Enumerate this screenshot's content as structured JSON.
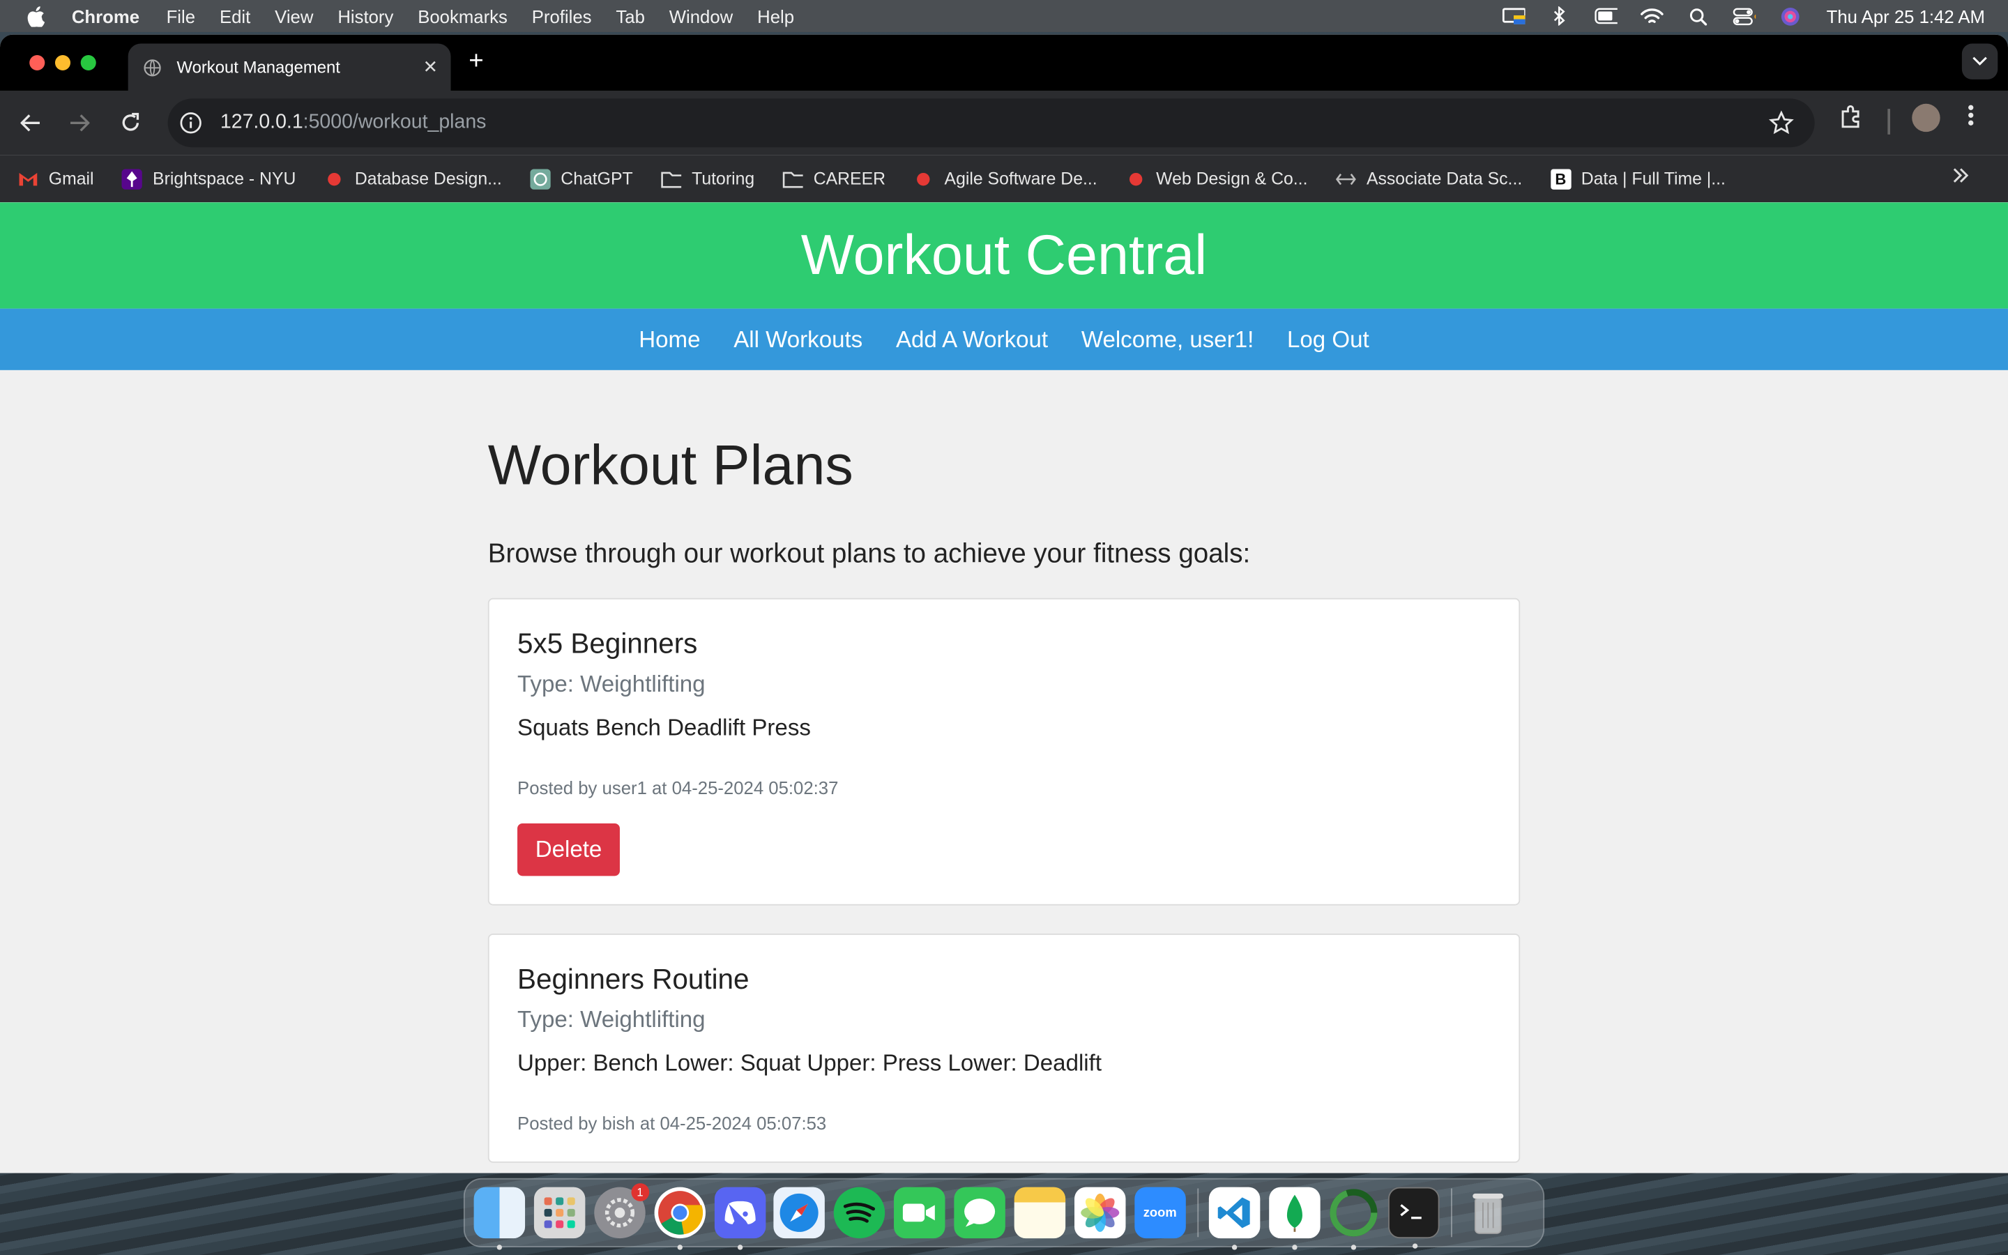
{
  "menubar": {
    "app_name": "Chrome",
    "items": [
      "File",
      "Edit",
      "View",
      "History",
      "Bookmarks",
      "Profiles",
      "Tab",
      "Window",
      "Help"
    ],
    "clock": "Thu Apr 25  1:42 AM"
  },
  "browser": {
    "tab_title": "Workout Management",
    "url_host": "127.0.0.1",
    "url_path": ":5000/workout_plans",
    "bookmarks": [
      {
        "label": "Gmail",
        "icon": "gmail-icon"
      },
      {
        "label": "Brightspace - NYU",
        "icon": "brightspace-icon"
      },
      {
        "label": "Database Design...",
        "icon": "red-bookmark-icon"
      },
      {
        "label": "ChatGPT",
        "icon": "chatgpt-icon"
      },
      {
        "label": "Tutoring",
        "icon": "folder-icon"
      },
      {
        "label": "CAREER",
        "icon": "folder-icon"
      },
      {
        "label": "Agile Software De...",
        "icon": "red-bookmark-icon"
      },
      {
        "label": "Web Design & Co...",
        "icon": "red-bookmark-icon"
      },
      {
        "label": "Associate Data Sc...",
        "icon": "datacamp-icon"
      },
      {
        "label": "Data | Full Time |...",
        "icon": "b-icon"
      }
    ]
  },
  "site": {
    "title": "Workout Central",
    "nav": [
      "Home",
      "All Workouts",
      "Add A Workout",
      "Welcome, user1!",
      "Log Out"
    ]
  },
  "main": {
    "heading": "Workout Plans",
    "lead": "Browse through our workout plans to achieve your fitness goals:",
    "plans": [
      {
        "name": "5x5 Beginners",
        "type": "Type: Weightlifting",
        "description": "Squats Bench Deadlift Press",
        "meta": "Posted by user1 at 04-25-2024 05:02:37",
        "delete_label": "Delete"
      },
      {
        "name": "Beginners Routine",
        "type": "Type: Weightlifting",
        "description": "Upper: Bench Lower: Squat Upper: Press Lower: Deadlift",
        "meta": "Posted by bish at 04-25-2024 05:07:53"
      }
    ]
  },
  "dock": {
    "apps": [
      "Finder",
      "Launchpad",
      "System Settings",
      "Chrome",
      "Discord",
      "Safari",
      "Spotify",
      "FaceTime",
      "Messages",
      "Notes",
      "Photos",
      "zoom",
      "VS Code",
      "MongoDB Compass",
      "Activity",
      "Terminal",
      "Trash"
    ],
    "settings_badge": "1"
  },
  "colors": {
    "header_green": "#2ecc71",
    "nav_blue": "#3498db",
    "delete_red": "#dc3545"
  }
}
